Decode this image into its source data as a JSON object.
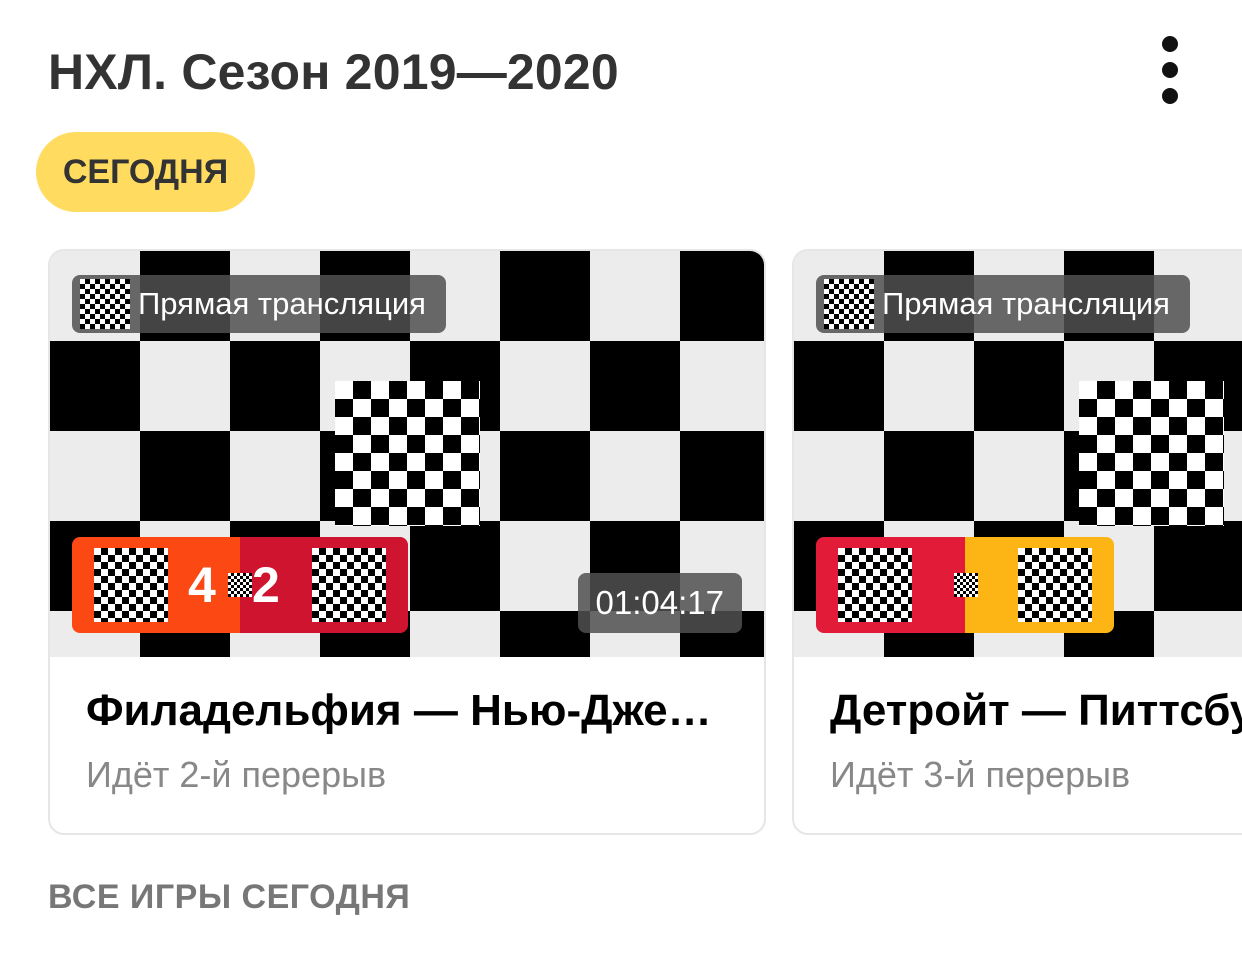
{
  "header": {
    "title": "НХЛ. Сезон 2019—2020",
    "more_icon": "more-vertical-icon"
  },
  "filters": {
    "today_label": "СЕГОДНЯ",
    "today_color": "#ffdc60"
  },
  "games": [
    {
      "live_label": "Прямая трансляция",
      "home_score": "4",
      "away_score": "2",
      "home_color": "#fc4813",
      "away_color": "#cf1430",
      "duration": "01:04:17",
      "title": "Филадельфия — Нью-Джерси",
      "status": "Идёт 2-й перерыв"
    },
    {
      "live_label": "Прямая трансляция",
      "home_score": "",
      "away_score": "",
      "home_color": "#e21b38",
      "away_color": "#fcb514",
      "duration": "",
      "title": "Детройт — Питтсбург",
      "status": "Идёт 3-й перерыв"
    }
  ],
  "footer": {
    "all_games_label": "ВСЕ ИГРЫ СЕГОДНЯ"
  }
}
